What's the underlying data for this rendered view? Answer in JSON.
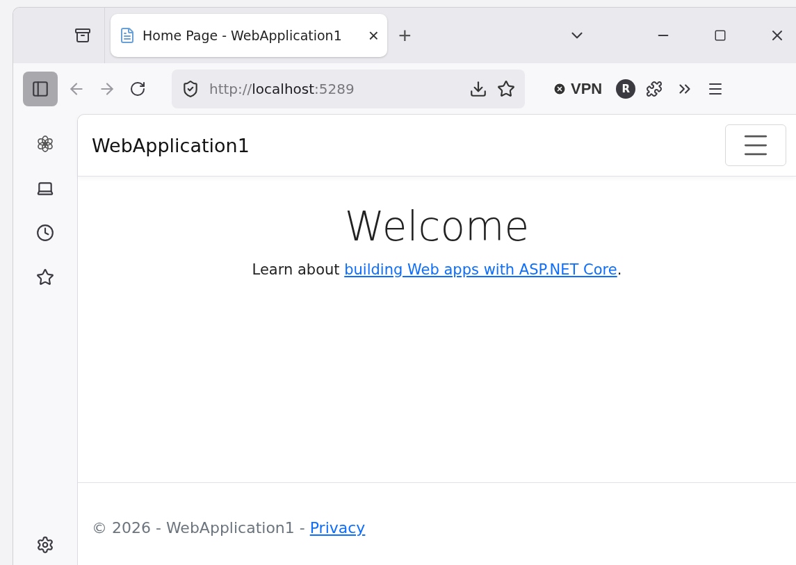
{
  "tab": {
    "title": "Home Page - WebApplication1",
    "close": "×",
    "selected": true
  },
  "new_tab": "+",
  "address": {
    "scheme": "http://",
    "host": "localhost",
    "port": ":5289"
  },
  "vpn": {
    "label": "VPN"
  },
  "profile": {
    "initial": "R"
  },
  "page": {
    "brand": "WebApplication1",
    "heading": "Welcome",
    "lead": "Learn about ",
    "link": "building Web apps with ASP.NET Core",
    "lead_end": ".",
    "footer": "© 2026 - WebApplication1 - ",
    "footer_link": "Privacy"
  }
}
